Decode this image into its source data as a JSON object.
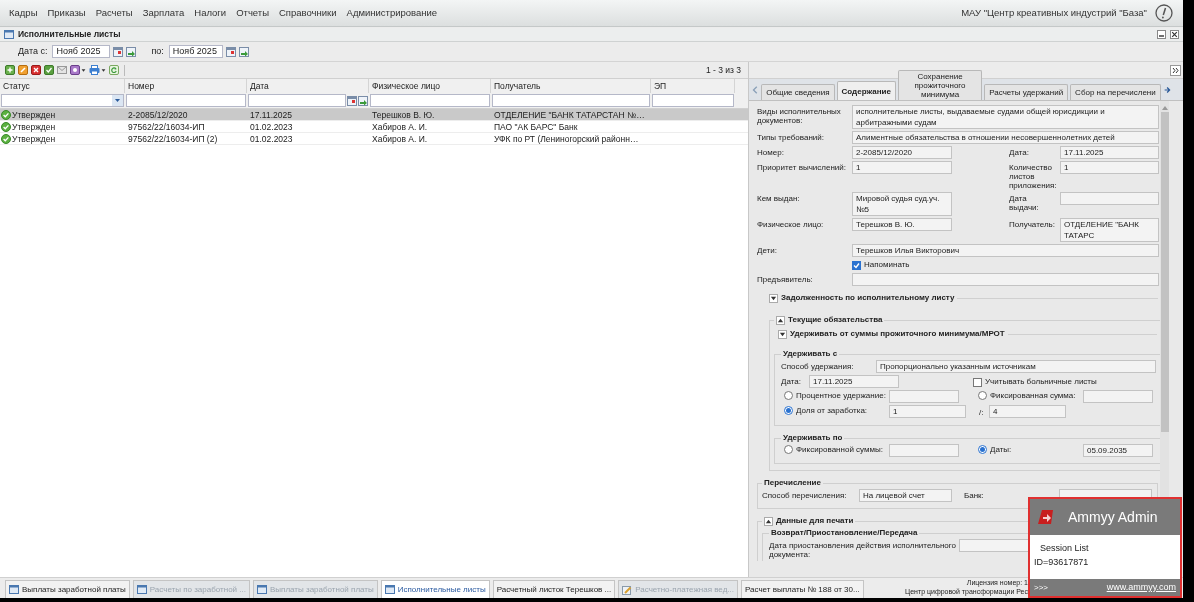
{
  "menu": [
    "Кадры",
    "Приказы",
    "Расчеты",
    "Зарплата",
    "Налоги",
    "Отчеты",
    "Справочники",
    "Администрирование"
  ],
  "organization": "МАУ \"Центр креативных индустрий \"База\"",
  "window": {
    "title": "Исполнительные листы"
  },
  "date_filter": {
    "from_label": "Дата с:",
    "from_value": "Нояб 2025",
    "to_label": "по:",
    "to_value": "Нояб 2025"
  },
  "pager": "1 - 3 из 3",
  "grid": {
    "columns": [
      "Статус",
      "Номер",
      "Дата",
      "Физическое лицо",
      "Получатель",
      "ЭП"
    ],
    "rows": [
      {
        "selected": true,
        "status": "Утвержден",
        "number": "2-2085/12/2020",
        "date": "17.11.2025",
        "person": "Терешков В. Ю.",
        "recipient": "ОТДЕЛЕНИЕ \"БАНК ТАТАРСТАН №…"
      },
      {
        "selected": false,
        "status": "Утвержден",
        "number": "97562/22/16034-ИП",
        "date": "01.02.2023",
        "person": "Хабиров А. И.",
        "recipient": "ПАО \"АК БАРС\" Банк"
      },
      {
        "selected": false,
        "status": "Утвержден",
        "number": "97562/22/16034-ИП (2)",
        "date": "01.02.2023",
        "person": "Хабиров А. И.",
        "recipient": "УФК по РТ (Лениногорский районн…"
      }
    ]
  },
  "detail": {
    "tabs": [
      {
        "label": "Общие сведения",
        "selected": false
      },
      {
        "label": "Содержание",
        "selected": true
      },
      {
        "label": "Сохранение прожиточного минимума",
        "selected": false
      },
      {
        "label": "Расчеты удержаний",
        "selected": false
      },
      {
        "label": "Сбор на перечислени",
        "selected": false
      }
    ],
    "fields": [
      {
        "kind": "wide",
        "label": "Виды исполнительных документов:",
        "value": "исполнительные листы, выдаваемые судами общей юрисдикции и арбитражными судам"
      },
      {
        "kind": "wide",
        "label": "Типы требований:",
        "value": "Алиментные обязательства в отношении несовершеннолетних детей"
      },
      {
        "kind": "pair",
        "label": "Номер:",
        "value": "2-2085/12/2020",
        "label2": "Дата:",
        "value2": "17.11.2025"
      },
      {
        "kind": "pair",
        "label": "Приоритет вычислений:",
        "value": "1",
        "label2": "Количество листов приложения:",
        "value2": "1"
      },
      {
        "kind": "pair",
        "label": "Кем выдан:",
        "value": "Мировой судья суд.уч. №5",
        "label2": "Дата выдачи:"
      },
      {
        "kind": "pair",
        "label": "Физическое лицо:",
        "value": "Терешков В. Ю.",
        "label2": "Получатель:",
        "value2": "ОТДЕЛЕНИЕ \"БАНК ТАТАРС"
      },
      {
        "kind": "wide",
        "label": "Дети:",
        "value": "Терешков Илья Викторович"
      },
      {
        "kind": "checkbox",
        "label": "Напоминать",
        "checked": true
      },
      {
        "kind": "wide",
        "label": "Предъявитель:"
      }
    ],
    "debt": {
      "title": "Задолженность по исполнительному листу",
      "expanded": false
    },
    "obligations": {
      "title": "Текущие обязательства",
      "expanded": true,
      "subsection": {
        "title": "Удерживать от суммы прожиточного минимума/МРОТ",
        "expanded": false
      },
      "hold_from": {
        "title": "Удерживать с",
        "method_label": "Способ удержания:",
        "method_value": "Пропорционально указанным источникам",
        "date_label": "Дата:",
        "date_value": "17.11.2025",
        "sick_leave": {
          "label": "Учитывать больничные листы",
          "checked": false
        },
        "options": [
          {
            "label": "Процентное удержание:",
            "selected": false
          },
          {
            "label": "Фиксированная сумма:",
            "selected": false
          },
          {
            "label": "Доля от заработка:",
            "selected": true,
            "value": "1",
            "separator": "/:",
            "value2": "4"
          }
        ]
      },
      "hold_to": {
        "title": "Удерживать по",
        "options": [
          {
            "label": "Фиксированной суммы:",
            "selected": false
          },
          {
            "label": "Даты:",
            "selected": true,
            "value": "05.09.2035"
          }
        ]
      }
    },
    "transfer": {
      "title": "Перечисление",
      "method_label": "Способ перечисления:",
      "method_value": "На лицевой счет",
      "bank_label": "Банк:"
    },
    "print": {
      "title": "Данные для печати",
      "expanded": true,
      "group_title": "Возврат/Приостановление/Передача",
      "field_label": "Дата приостановления действия исполнительного документа:"
    }
  },
  "taskbar": [
    {
      "label": "Выплаты заработной платы",
      "kind": "window",
      "selected": false,
      "dimmed": false
    },
    {
      "label": "Расчеты по заработной ...",
      "kind": "window",
      "selected": false,
      "dimmed": true
    },
    {
      "label": "Выплаты заработной платы",
      "kind": "window",
      "selected": false,
      "dimmed": true
    },
    {
      "label": "Исполнительные листы",
      "kind": "window",
      "selected": true,
      "dimmed": false
    },
    {
      "label": "Расчетный листок Терешков ...",
      "kind": "plain",
      "selected": false,
      "dimmed": false
    },
    {
      "label": "Расчетно-платежная вед...",
      "kind": "document",
      "selected": false,
      "dimmed": true
    },
    {
      "label": "Расчет выплаты № 188 от 30...",
      "kind": "plain",
      "selected": false,
      "dimmed": false
    }
  ],
  "license": [
    "Лицензия номер: 1",
    "Центр цифровой трансформации Рес"
  ],
  "popup": {
    "title": "Ammyy Admin",
    "items": [
      "Session List",
      "ID=93617871"
    ],
    "more": ">>>",
    "link": "www.ammyy.com"
  }
}
